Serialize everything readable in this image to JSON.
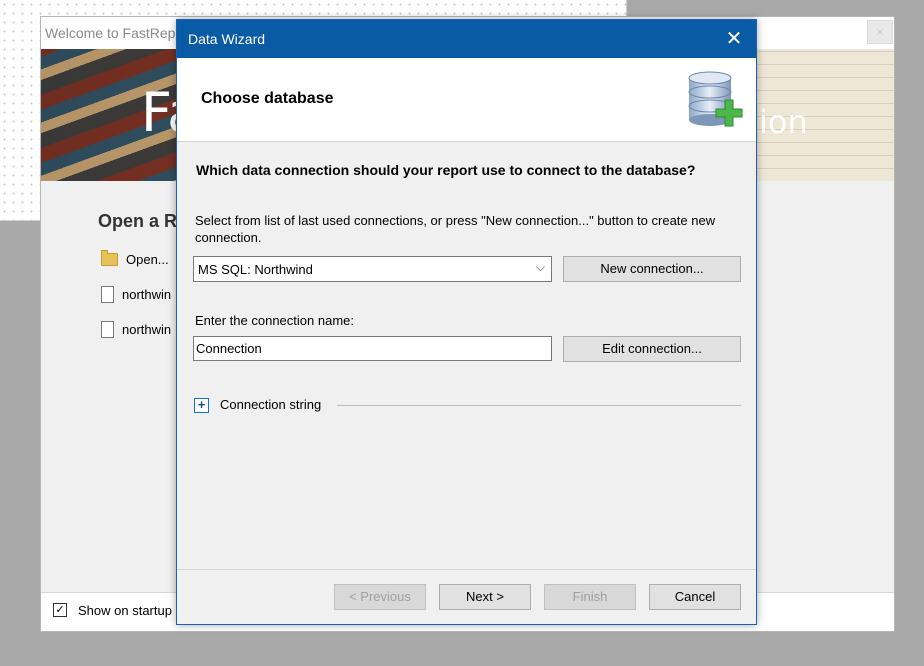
{
  "welcome": {
    "title": "Welcome to FastRep",
    "close_glyph": "×",
    "banner_word_left": "Fa",
    "banner_word_right": "ion",
    "open_heading": "Open a R",
    "recent": [
      {
        "label": "Open...",
        "icon": "folder-icon"
      },
      {
        "label": "northwin",
        "icon": "document-icon"
      },
      {
        "label": "northwin",
        "icon": "document-icon"
      }
    ],
    "show_on_startup_label": "Show on startup",
    "show_on_startup_checked": "✓"
  },
  "wizard": {
    "title": "Data Wizard",
    "close_glyph": "✕",
    "header_title": "Choose database",
    "question": "Which data connection should your report use to connect to the database?",
    "instructions": "Select from list of last used connections, or press \"New connection...\" button to create new connection.",
    "connection_select_value": "MS SQL: Northwind",
    "connection_select_arrow": "⌵",
    "new_connection_label": "New connection...",
    "connection_name_label": "Enter the connection name:",
    "connection_name_value": "Connection",
    "edit_connection_label": "Edit connection...",
    "connection_string_toggle": "+",
    "connection_string_label": "Connection string",
    "buttons": {
      "previous": "< Previous",
      "next": "Next >",
      "finish": "Finish",
      "cancel": "Cancel"
    }
  },
  "colors": {
    "wizard_titlebar": "#0a5ba6",
    "accent_green": "#4cb84c"
  }
}
